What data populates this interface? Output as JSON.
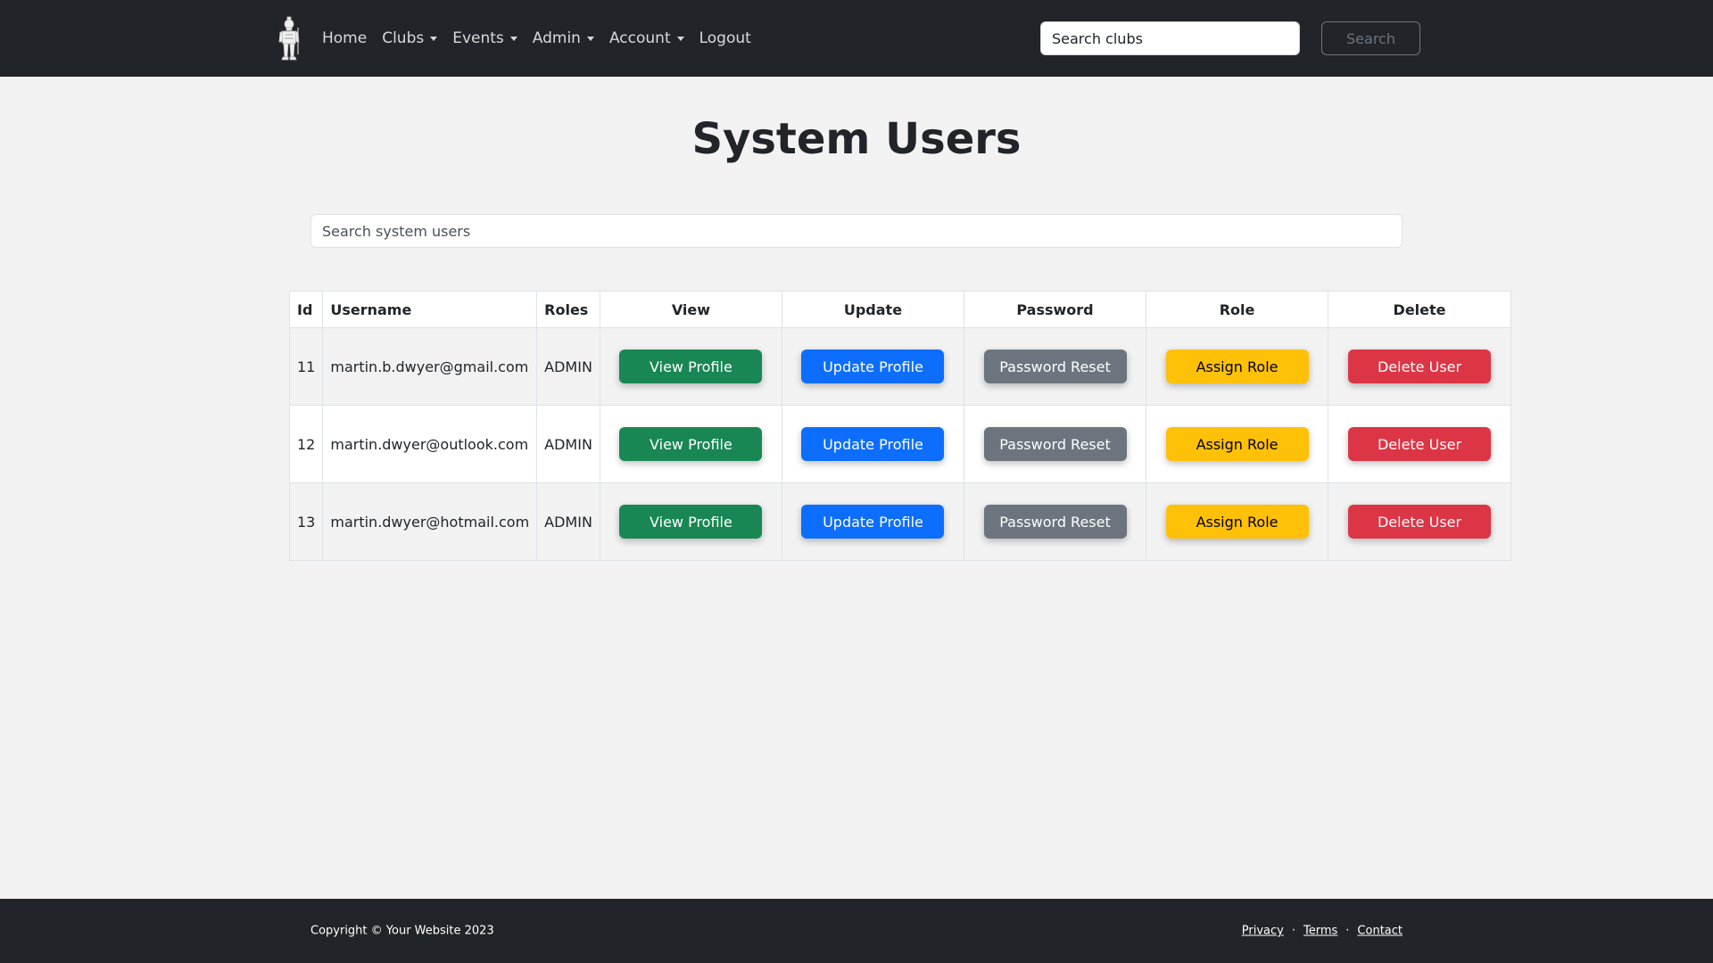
{
  "navbar": {
    "links": [
      "Home",
      "Clubs",
      "Events",
      "Admin",
      "Account",
      "Logout"
    ],
    "search_placeholder": "Search clubs",
    "search_button": "Search"
  },
  "page": {
    "title": "System Users",
    "search_placeholder": "Search system users"
  },
  "table": {
    "headers": [
      "Id",
      "Username",
      "Roles",
      "View",
      "Update",
      "Password",
      "Role",
      "Delete"
    ],
    "rows": [
      {
        "id": "11",
        "username": "martin.b.dwyer@gmail.com",
        "roles": "ADMIN"
      },
      {
        "id": "12",
        "username": "martin.dwyer@outlook.com",
        "roles": "ADMIN"
      },
      {
        "id": "13",
        "username": "martin.dwyer@hotmail.com",
        "roles": "ADMIN"
      }
    ],
    "buttons": {
      "view": "View Profile",
      "update": "Update Profile",
      "password": "Password Reset",
      "role": "Assign Role",
      "delete": "Delete User"
    }
  },
  "footer": {
    "copyright": "Copyright © Your Website 2023",
    "links": [
      "Privacy",
      "Terms",
      "Contact"
    ],
    "separator": "·"
  },
  "colors": {
    "navbar_bg": "#212529",
    "page_bg": "#f2f2f2",
    "view_button": "#198754",
    "update_button": "#0d6efd",
    "password_button": "#6c757d",
    "role_button": "#ffc107",
    "delete_button": "#dc3545"
  },
  "icons": {
    "brand": "knight-logo-icon",
    "dropdown": "caret-down-icon"
  }
}
